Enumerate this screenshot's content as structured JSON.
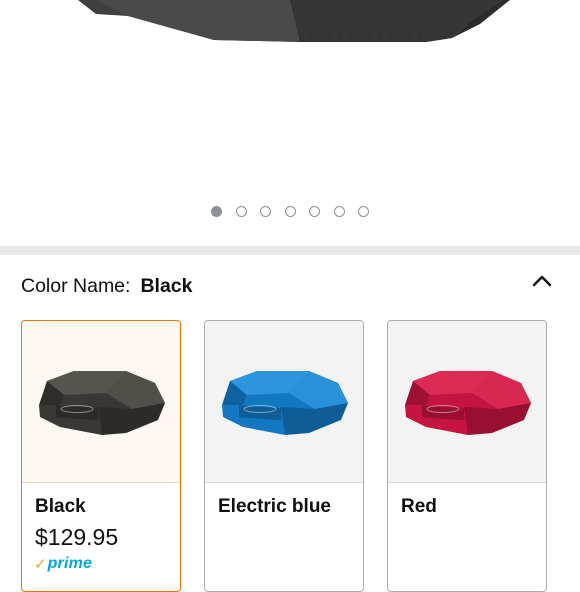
{
  "gallery": {
    "dot_count": 7,
    "active_index": 0
  },
  "color_selector": {
    "label": "Color Name:",
    "selected_value": "Black",
    "options": [
      {
        "name": "Black",
        "price": "$129.95",
        "prime": "prime",
        "body_color": "#3a3834",
        "face_color": "#57544f",
        "selected": true
      },
      {
        "name": "Electric blue",
        "price": "",
        "prime": "",
        "body_color": "#1278c2",
        "face_color": "#2c95dd",
        "selected": false
      },
      {
        "name": "Red",
        "price": "",
        "prime": "",
        "body_color": "#c4143f",
        "face_color": "#dc2a55",
        "selected": false
      }
    ]
  },
  "colors": {
    "accent_selected": "#e77600",
    "prime_blue": "#00a8e1",
    "prime_check": "#f5a623"
  }
}
